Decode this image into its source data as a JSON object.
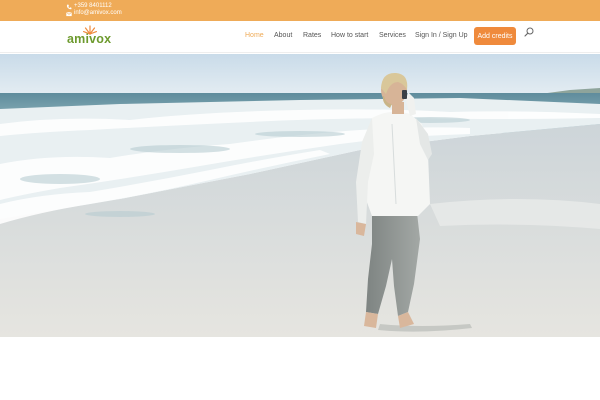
{
  "topbar": {
    "phone": "+359 8401112",
    "email": "info@amivox.com",
    "phone_icon": "phone-icon",
    "email_icon": "envelope-icon",
    "background": "#efab58"
  },
  "header": {
    "logo_text": "amivox",
    "logo_color": "#6d9a2e",
    "logo_accent": "#ef8a3c"
  },
  "nav": {
    "items": [
      {
        "label": "Home",
        "active": true
      },
      {
        "label": "About",
        "active": false
      },
      {
        "label": "Rates",
        "active": false
      },
      {
        "label": "How to start",
        "active": false
      },
      {
        "label": "Services",
        "active": false
      },
      {
        "label": "Sign In / Sign Up",
        "active": false
      }
    ],
    "cta_label": "Add credits",
    "search_icon": "search-icon",
    "active_color": "#efab58",
    "cta_color": "#ef8a3c"
  },
  "hero": {
    "image": "beach-woman-phone-photo"
  }
}
